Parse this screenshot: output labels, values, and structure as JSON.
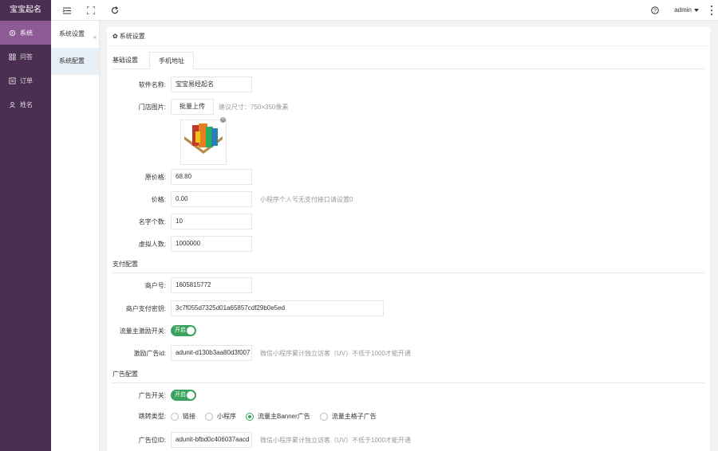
{
  "app": {
    "brand": "宝宝起名"
  },
  "sidebar": {
    "items": [
      {
        "label": "系统",
        "icon": "settings-icon"
      },
      {
        "label": "问答",
        "icon": "grid-icon"
      },
      {
        "label": "订单",
        "icon": "order-icon"
      },
      {
        "label": "姓名",
        "icon": "user-icon"
      }
    ]
  },
  "topbar": {
    "user": "admin"
  },
  "subnav": {
    "items": [
      {
        "label": "系统设置"
      },
      {
        "label": "系统配置"
      }
    ],
    "collapse_glyph": "«"
  },
  "card": {
    "title": "系统设置"
  },
  "tabs": {
    "basic": "基础设置",
    "mobile": "手机地址"
  },
  "form": {
    "software_name": {
      "label": "软件名称:",
      "value": "宝宝易经起名"
    },
    "shop_image": {
      "label": "门店图片:",
      "button": "批量上传",
      "hint": "建议尺寸：750×350像素"
    },
    "original_price": {
      "label": "原价格:",
      "value": "68.80"
    },
    "price": {
      "label": "价格:",
      "value": "0.00",
      "hint": "小程序个人号无支付接口请设置0"
    },
    "name_count": {
      "label": "名字个数:",
      "value": "10"
    },
    "virtual_count": {
      "label": "虚拟人数:",
      "value": "1000000"
    }
  },
  "payment": {
    "section_title": "支付配置",
    "merchant_id": {
      "label": "商户号:",
      "value": "1605815772"
    },
    "merchant_key": {
      "label": "商户支付密钥:",
      "value": "3c7f055d7325d01a65857cdf29b0e5ed"
    },
    "incentive_switch": {
      "label": "流量主激励开关:",
      "state": "开启"
    },
    "incentive_ad_id": {
      "label": "激励广告id:",
      "value": "adunit-d130b3aa80d3f007",
      "hint": "微信小程序累计独立访客（UV）不低于1000才能开通"
    }
  },
  "ads": {
    "section_title": "广告配置",
    "ad_switch": {
      "label": "广告开关:",
      "state": "开启"
    },
    "jump_type": {
      "label": "跳转类型:",
      "options": [
        "链接",
        "小程序",
        "流量主Banner广告",
        "流量主格子广告"
      ],
      "selected": "流量主Banner广告"
    },
    "ad_slot_id": {
      "label": "广告位ID:",
      "value": "adunit-bfbd0c406037aacd",
      "hint": "微信小程序累计独立访客（UV）不低于1000才能开通"
    }
  },
  "colors": {
    "sidebar_bg": "#4a2f52",
    "sidebar_active": "#8e5a96",
    "switch_on": "#3aa360"
  }
}
